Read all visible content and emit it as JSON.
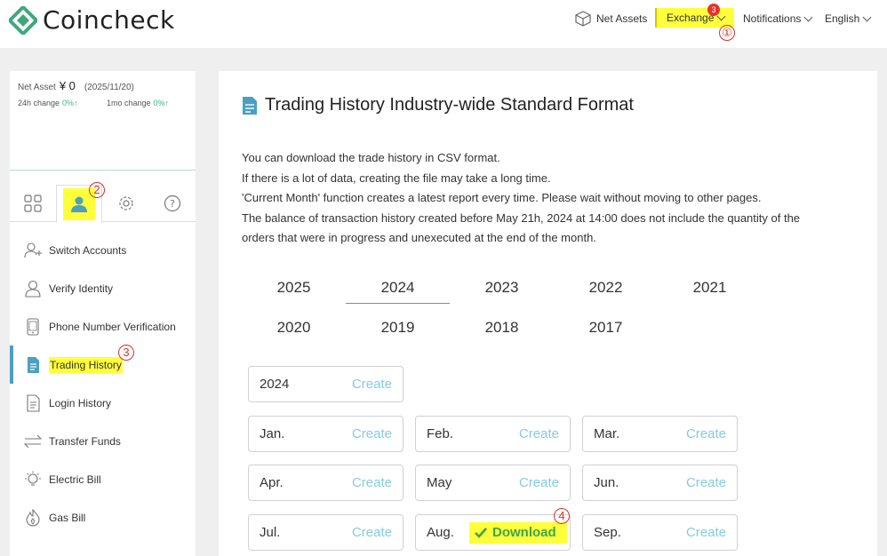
{
  "header": {
    "logo_text": "Coincheck",
    "net_assets": "Net Assets",
    "exchange": "Exchange",
    "exchange_badge": "3",
    "notifications": "Notifications",
    "language": "English"
  },
  "markers": {
    "m1": "①",
    "m2": "2",
    "m3": "3",
    "m4": "4"
  },
  "sidebar": {
    "net_asset_label": "Net Asset",
    "net_asset_value": "¥ 0",
    "net_asset_date": "(2025/11/20)",
    "change_24h_label": "24h change",
    "change_24h_value": "0%↑",
    "change_1mo_label": "1mo change",
    "change_1mo_value": "0%↑",
    "menu": [
      {
        "label": "Switch Accounts"
      },
      {
        "label": "Verify Identity"
      },
      {
        "label": "Phone Number Verification"
      },
      {
        "label": "Trading History"
      },
      {
        "label": "Login History"
      },
      {
        "label": "Transfer Funds"
      },
      {
        "label": "Electric Bill"
      },
      {
        "label": "Gas Bill"
      }
    ]
  },
  "main": {
    "title": "Trading History Industry-wide Standard Format",
    "desc": [
      "You can download the trade history in CSV format.",
      "If there is a lot of data, creating the file may take a long time.",
      "'Current Month' function creates a latest report every time. Please wait without moving to other pages.",
      "The balance of transaction history created before May 21h, 2024 at 14:00 does not include the quantity of the",
      "orders that were in progress and unexecuted at the end of the month."
    ],
    "years": [
      "2025",
      "2024",
      "2023",
      "2022",
      "2021",
      "2020",
      "2019",
      "2018",
      "2017"
    ],
    "selected_year": "2024",
    "year_card": {
      "label": "2024",
      "action": "Create"
    },
    "months": [
      {
        "label": "Jan.",
        "action": "Create"
      },
      {
        "label": "Feb.",
        "action": "Create"
      },
      {
        "label": "Mar.",
        "action": "Create"
      },
      {
        "label": "Apr.",
        "action": "Create"
      },
      {
        "label": "May",
        "action": "Create"
      },
      {
        "label": "Jun.",
        "action": "Create"
      },
      {
        "label": "Jul.",
        "action": "Create"
      },
      {
        "label": "Aug.",
        "action": "Download"
      },
      {
        "label": "Sep.",
        "action": "Create"
      }
    ]
  },
  "colors": {
    "accent": "#4c9fc2",
    "create": "#86cbe0",
    "download": "#3aa84a",
    "highlight": "#ffff3b",
    "marker": "#d9312a"
  }
}
